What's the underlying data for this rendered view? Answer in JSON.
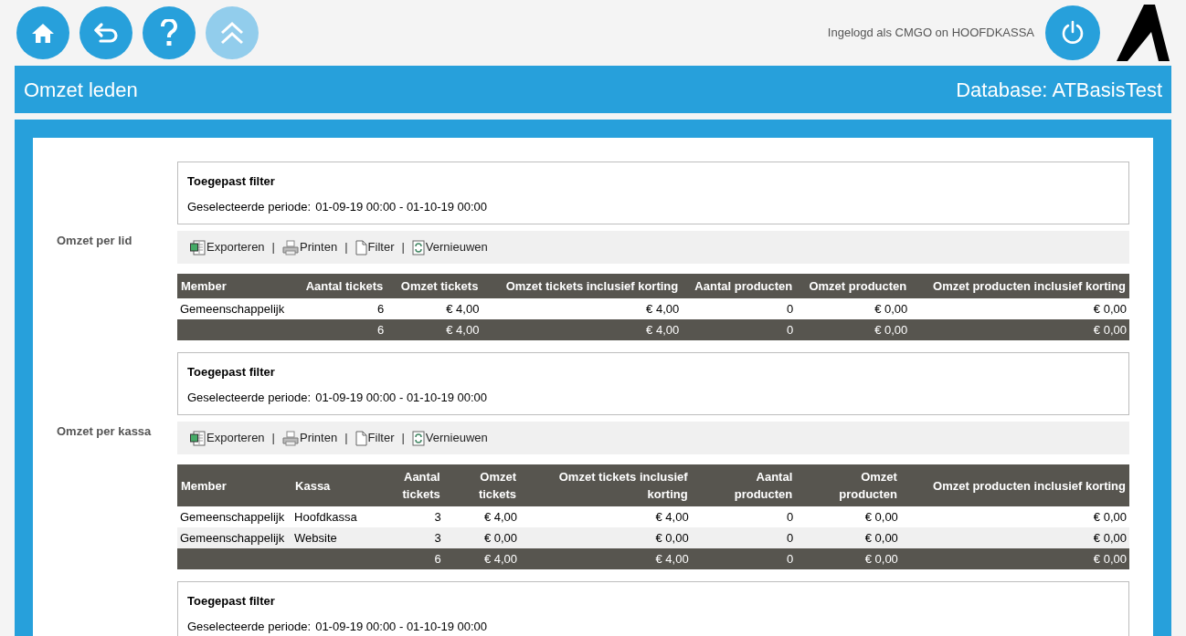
{
  "nav_buttons": [
    {
      "kind": "home",
      "disabled": false
    },
    {
      "kind": "back",
      "disabled": false
    },
    {
      "kind": "help",
      "disabled": false
    },
    {
      "kind": "top",
      "disabled": true
    }
  ],
  "login_text": "Ingelogd als CMGO on HOOFDKASSA",
  "title_bar": {
    "title": "Omzet leden",
    "database": "Database: ATBasisTest"
  },
  "sections": [
    {
      "label": "Omzet per lid",
      "filter": {
        "title": "Toegepast filter",
        "period_label": "Geselecteerde periode:",
        "period": "01-09-19 00:00 - 01-10-19 00:00"
      },
      "toolbar": [
        {
          "kind": "export",
          "label": "Exporteren"
        },
        {
          "kind": "separator",
          "label": "|"
        },
        {
          "kind": "print",
          "label": "Printen"
        },
        {
          "kind": "separator",
          "label": "|"
        },
        {
          "kind": "filter",
          "label": "Filter"
        },
        {
          "kind": "separator",
          "label": "|"
        },
        {
          "kind": "refresh",
          "label": "Vernieuwen"
        }
      ],
      "table": {
        "columns": [
          "Member",
          "Aantal tickets",
          "Omzet tickets",
          "Omzet tickets inclusief korting",
          "Aantal producten",
          "Omzet producten",
          "Omzet producten inclusief korting"
        ],
        "rows": [
          {
            "kind": "data",
            "cells": [
              "Gemeenschappelijk",
              "6",
              "€ 4,00",
              "€ 4,00",
              "0",
              "€ 0,00",
              "€ 0,00"
            ]
          },
          {
            "kind": "total",
            "cells": [
              "",
              "6",
              "€ 4,00",
              "€ 4,00",
              "0",
              "€ 0,00",
              "€ 0,00"
            ]
          }
        ]
      }
    },
    {
      "label": "Omzet per kassa",
      "filter": {
        "title": "Toegepast filter",
        "period_label": "Geselecteerde periode:",
        "period": "01-09-19 00:00 - 01-10-19 00:00"
      },
      "toolbar": [
        {
          "kind": "export",
          "label": "Exporteren"
        },
        {
          "kind": "separator",
          "label": "|"
        },
        {
          "kind": "print",
          "label": "Printen"
        },
        {
          "kind": "separator",
          "label": "|"
        },
        {
          "kind": "filter",
          "label": "Filter"
        },
        {
          "kind": "separator",
          "label": "|"
        },
        {
          "kind": "refresh",
          "label": "Vernieuwen"
        }
      ],
      "table": {
        "columns": [
          "Member",
          "Kassa",
          "Aantal tickets",
          "Omzet tickets",
          "Omzet tickets inclusief korting",
          "Aantal producten",
          "Omzet producten",
          "Omzet producten inclusief korting"
        ],
        "rows": [
          {
            "kind": "data",
            "cells": [
              "Gemeenschappelijk",
              "Hoofdkassa",
              "3",
              "€ 4,00",
              "€ 4,00",
              "0",
              "€ 0,00",
              "€ 0,00"
            ]
          },
          {
            "kind": "data",
            "cells": [
              "Gemeenschappelijk",
              "Website",
              "3",
              "€ 0,00",
              "€ 0,00",
              "0",
              "€ 0,00",
              "€ 0,00"
            ]
          },
          {
            "kind": "total",
            "cells": [
              "",
              "",
              "6",
              "€ 4,00",
              "€ 4,00",
              "0",
              "€ 0,00",
              "€ 0,00"
            ]
          }
        ]
      }
    },
    {
      "filter": {
        "title": "Toegepast filter",
        "period_label": "Geselecteerde periode:",
        "period": "01-09-19 00:00 - 01-10-19 00:00"
      }
    }
  ]
}
